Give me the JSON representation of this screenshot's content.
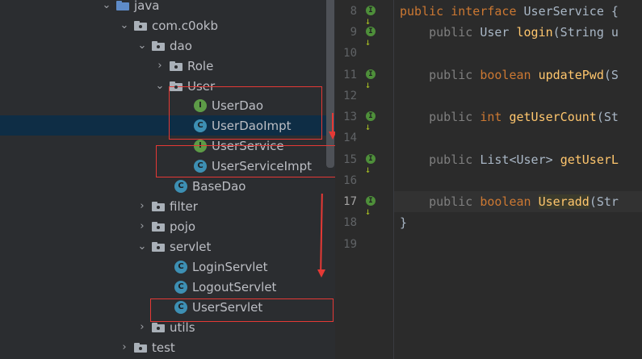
{
  "tree": {
    "items": [
      {
        "label": "java",
        "kind": "folder-blue",
        "arrow": "down"
      },
      {
        "label": "com.c0okb",
        "kind": "package",
        "arrow": "down"
      },
      {
        "label": "dao",
        "kind": "package",
        "arrow": "down"
      },
      {
        "label": "Role",
        "kind": "package",
        "arrow": "right"
      },
      {
        "label": "User",
        "kind": "package",
        "arrow": "down"
      },
      {
        "label": "UserDao",
        "kind": "interface",
        "badge": "I"
      },
      {
        "label": "UserDaoImpt",
        "kind": "class",
        "badge": "C",
        "selected": true
      },
      {
        "label": "UserService",
        "kind": "interface",
        "badge": "I"
      },
      {
        "label": "UserServiceImpt",
        "kind": "class",
        "badge": "C"
      },
      {
        "label": "BaseDao",
        "kind": "class",
        "badge": "C"
      },
      {
        "label": "filter",
        "kind": "package",
        "arrow": "right"
      },
      {
        "label": "pojo",
        "kind": "package",
        "arrow": "right"
      },
      {
        "label": "servlet",
        "kind": "package",
        "arrow": "down"
      },
      {
        "label": "LoginServlet",
        "kind": "class",
        "badge": "C"
      },
      {
        "label": "LogoutServlet",
        "kind": "class",
        "badge": "C"
      },
      {
        "label": "UserServlet",
        "kind": "class",
        "badge": "C"
      },
      {
        "label": "utils",
        "kind": "package",
        "arrow": "right"
      },
      {
        "label": "test",
        "kind": "package",
        "arrow": "right"
      }
    ]
  },
  "editor": {
    "line_numbers": [
      "8",
      "9",
      "10",
      "11",
      "12",
      "13",
      "14",
      "15",
      "16",
      "17",
      "18",
      "19"
    ],
    "current_line": "17",
    "gutter_badge": "I",
    "lines": {
      "l8_kw1": "public ",
      "l8_kw2": "interface ",
      "l8_name": "UserService {",
      "l9_kw": "public ",
      "l9_type": "User ",
      "l9_fn": "login",
      "l9_rest": "(String u",
      "l11_kw": "public ",
      "l11_kw2": "boolean ",
      "l11_fn": "updatePwd",
      "l11_rest": "(S",
      "l13_kw": "public ",
      "l13_kw2": "int ",
      "l13_fn": "getUserCount",
      "l13_rest": "(St",
      "l15_kw": "public ",
      "l15_type": "List<User> ",
      "l15_fn": "getUserL",
      "l17_kw": "public ",
      "l17_kw2": "boolean ",
      "l17_fn": "Useradd",
      "l17_rest": "(Str",
      "l18": "}"
    }
  },
  "colors": {
    "annotation": "#e53935",
    "selection": "#0e2d45",
    "keyword": "#cc7832",
    "method": "#ffc66d"
  }
}
